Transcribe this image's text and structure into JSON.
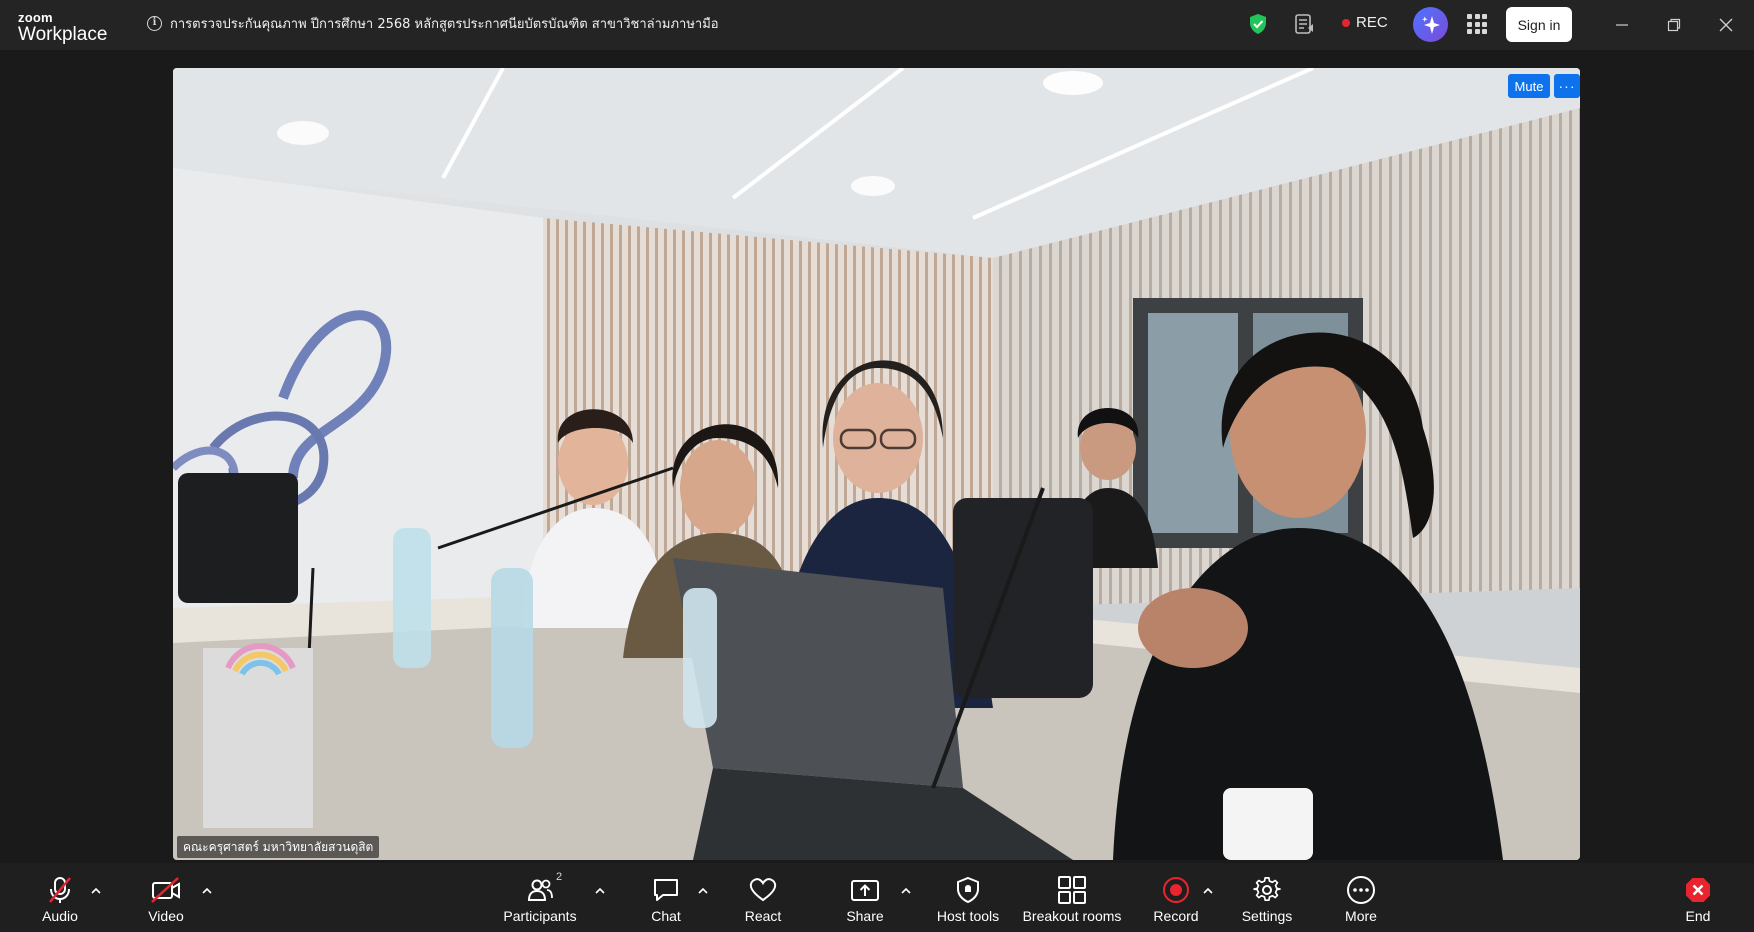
{
  "app": {
    "logo_line1": "zoom",
    "logo_line2": "Workplace"
  },
  "meeting": {
    "title": "การตรวจประกันคุณภาพ ปีการศึกษา 2568 หลักสูตรประกาศนียบัตรบัณฑิต สาขาวิชาล่ามภาษามือ"
  },
  "header": {
    "rec_label": "REC",
    "signin_label": "Sign in"
  },
  "video": {
    "participant_name": "คณะครุศาสตร์ มหาวิทยาลัยสวนดุสิต",
    "mute_label": "Mute",
    "more_label": "···"
  },
  "toolbar": {
    "audio_label": "Audio",
    "video_label": "Video",
    "participants_label": "Participants",
    "participants_count": "2",
    "chat_label": "Chat",
    "react_label": "React",
    "share_label": "Share",
    "host_tools_label": "Host tools",
    "breakout_label": "Breakout rooms",
    "record_label": "Record",
    "settings_label": "Settings",
    "more_label": "More",
    "end_label": "End"
  },
  "colors": {
    "accent": "#0e72ed",
    "record_red": "#e8242f",
    "shield_green": "#23c35b"
  },
  "icons": [
    "info-icon",
    "shield-icon",
    "notes-icon",
    "ai-companion-icon",
    "apps-grid-icon",
    "minimize-icon",
    "restore-icon",
    "close-icon",
    "mic-off-icon",
    "video-off-icon",
    "participants-icon",
    "chat-icon",
    "react-icon",
    "share-icon",
    "host-tools-icon",
    "breakout-icon",
    "record-icon",
    "settings-icon",
    "more-icon",
    "end-icon"
  ]
}
